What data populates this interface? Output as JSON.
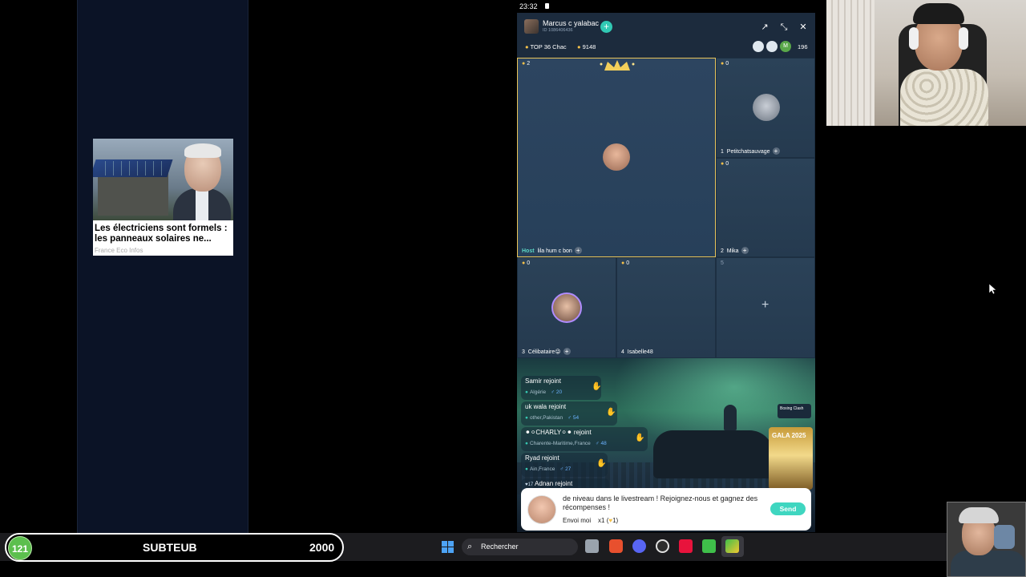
{
  "ad": {
    "title": "Les électriciens sont formels : les panneaux solaires ne...",
    "source": "France Eco Infos"
  },
  "status": {
    "time": "23:32"
  },
  "live": {
    "host_name": "Marcus c yalabac",
    "host_id": "ID 1086406436",
    "rank": "TOP 36 Chac",
    "coins": "9148",
    "viewer_initial": "M",
    "viewer_count": "196",
    "seats": [
      {
        "count": "2",
        "tag": "Host",
        "name": "lila hum c bon"
      },
      {
        "count": "0",
        "num": "1",
        "name": "Petitchatsauvage"
      },
      {
        "count": "0",
        "num": "2",
        "name": "Mika"
      },
      {
        "count": "0",
        "num": "3",
        "name": "Célibataire😜"
      },
      {
        "count": "0",
        "num": "4",
        "name": "Isabelle48"
      },
      {
        "num": "5"
      }
    ],
    "joins": [
      {
        "name": "Samir",
        "action": "rejoint",
        "loc": "Algérie",
        "age": "20"
      },
      {
        "name": "uk wala",
        "action": "rejoint",
        "loc": "other,Pakistan",
        "age": "54"
      },
      {
        "name": "⚫⚪CHARLY⚪⚫",
        "action": "rejoint",
        "loc": "Charente-Maritime,France",
        "age": "48"
      },
      {
        "name": "Ryad",
        "action": "rejoint",
        "loc": "Ain,France",
        "age": "27"
      },
      {
        "name": "Adnan",
        "action": "rejoint",
        "level": "17"
      }
    ],
    "side_badge": "Boxing Clash",
    "gala": "GALA 2025",
    "invite": {
      "text": "de niveau dans le livestream ! Rejoignez-nous et gagnez des récompenses !",
      "sub_label": "Envoi moi",
      "sub_value": "x1 (",
      "sub_value_end": "1)",
      "send": "Send"
    }
  },
  "sub_bar": {
    "count": "121",
    "label": "SUBTEUB",
    "goal": "2000"
  },
  "taskbar": {
    "search_placeholder": "Rechercher"
  },
  "colors": {
    "accent": "#31c9b4",
    "coin": "#f5c14a",
    "host_border": "#e8c45a",
    "sub_green": "#5cbf4e"
  }
}
